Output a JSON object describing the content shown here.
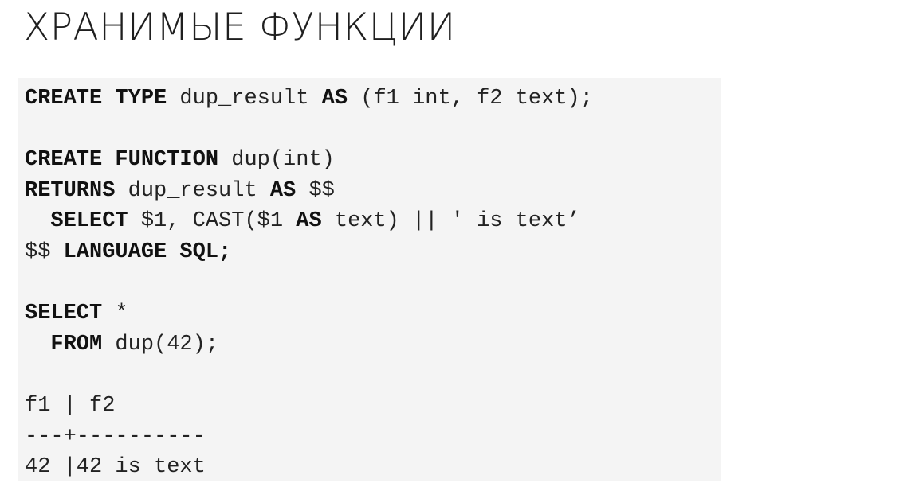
{
  "title": "ХРАНИМЫЕ ФУНКЦИИ",
  "code": {
    "l1": {
      "k1": "CREATE TYPE",
      "t1": " dup_result ",
      "k2": "AS",
      "t2": " (f1 int, f2 text);"
    },
    "l3": {
      "k1": "CREATE FUNCTION",
      "t1": " dup(int)"
    },
    "l4": {
      "k1": "RETURNS",
      "t1": " dup_result ",
      "k2": "AS",
      "t2": " $$"
    },
    "l5": {
      "t0": "  ",
      "k1": "SELECT",
      "t1": " $1, CAST($1 ",
      "k2": "AS",
      "t2": " text) || ' is text’"
    },
    "l6": {
      "t1": "$$ ",
      "k1": "LANGUAGE SQL;"
    },
    "l8": {
      "k1": "SELECT",
      "t1": " *"
    },
    "l9": {
      "t0": "  ",
      "k1": "FROM",
      "t1": " dup(42);"
    },
    "l11": {
      "t1": "f1 | f2"
    },
    "l12": {
      "t1": "---+----------"
    },
    "l13": {
      "t1": "42 |42 is text"
    }
  }
}
